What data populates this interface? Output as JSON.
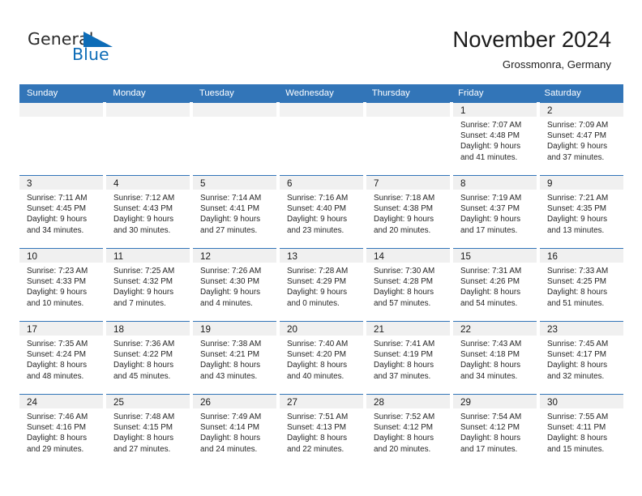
{
  "brand": {
    "word_one": "General",
    "word_two": "Blue",
    "triangle_icon": "blue-triangle-icon",
    "general_color": "#2b2b2b",
    "blue_color": "#0d6cb7"
  },
  "header": {
    "title": "November 2024",
    "subtitle": "Grossmonra, Germany"
  },
  "theme": {
    "header_blue": "#3275b8",
    "daynum_band": "#f0f0f0",
    "text": "#262626"
  },
  "weekdays": [
    "Sunday",
    "Monday",
    "Tuesday",
    "Wednesday",
    "Thursday",
    "Friday",
    "Saturday"
  ],
  "weeks": [
    [
      {
        "blank": true
      },
      {
        "blank": true
      },
      {
        "blank": true
      },
      {
        "blank": true
      },
      {
        "blank": true
      },
      {
        "day": "1",
        "sunrise": "Sunrise: 7:07 AM",
        "sunset": "Sunset: 4:48 PM",
        "daylight1": "Daylight: 9 hours",
        "daylight2": "and 41 minutes."
      },
      {
        "day": "2",
        "sunrise": "Sunrise: 7:09 AM",
        "sunset": "Sunset: 4:47 PM",
        "daylight1": "Daylight: 9 hours",
        "daylight2": "and 37 minutes."
      }
    ],
    [
      {
        "day": "3",
        "sunrise": "Sunrise: 7:11 AM",
        "sunset": "Sunset: 4:45 PM",
        "daylight1": "Daylight: 9 hours",
        "daylight2": "and 34 minutes."
      },
      {
        "day": "4",
        "sunrise": "Sunrise: 7:12 AM",
        "sunset": "Sunset: 4:43 PM",
        "daylight1": "Daylight: 9 hours",
        "daylight2": "and 30 minutes."
      },
      {
        "day": "5",
        "sunrise": "Sunrise: 7:14 AM",
        "sunset": "Sunset: 4:41 PM",
        "daylight1": "Daylight: 9 hours",
        "daylight2": "and 27 minutes."
      },
      {
        "day": "6",
        "sunrise": "Sunrise: 7:16 AM",
        "sunset": "Sunset: 4:40 PM",
        "daylight1": "Daylight: 9 hours",
        "daylight2": "and 23 minutes."
      },
      {
        "day": "7",
        "sunrise": "Sunrise: 7:18 AM",
        "sunset": "Sunset: 4:38 PM",
        "daylight1": "Daylight: 9 hours",
        "daylight2": "and 20 minutes."
      },
      {
        "day": "8",
        "sunrise": "Sunrise: 7:19 AM",
        "sunset": "Sunset: 4:37 PM",
        "daylight1": "Daylight: 9 hours",
        "daylight2": "and 17 minutes."
      },
      {
        "day": "9",
        "sunrise": "Sunrise: 7:21 AM",
        "sunset": "Sunset: 4:35 PM",
        "daylight1": "Daylight: 9 hours",
        "daylight2": "and 13 minutes."
      }
    ],
    [
      {
        "day": "10",
        "sunrise": "Sunrise: 7:23 AM",
        "sunset": "Sunset: 4:33 PM",
        "daylight1": "Daylight: 9 hours",
        "daylight2": "and 10 minutes."
      },
      {
        "day": "11",
        "sunrise": "Sunrise: 7:25 AM",
        "sunset": "Sunset: 4:32 PM",
        "daylight1": "Daylight: 9 hours",
        "daylight2": "and 7 minutes."
      },
      {
        "day": "12",
        "sunrise": "Sunrise: 7:26 AM",
        "sunset": "Sunset: 4:30 PM",
        "daylight1": "Daylight: 9 hours",
        "daylight2": "and 4 minutes."
      },
      {
        "day": "13",
        "sunrise": "Sunrise: 7:28 AM",
        "sunset": "Sunset: 4:29 PM",
        "daylight1": "Daylight: 9 hours",
        "daylight2": "and 0 minutes."
      },
      {
        "day": "14",
        "sunrise": "Sunrise: 7:30 AM",
        "sunset": "Sunset: 4:28 PM",
        "daylight1": "Daylight: 8 hours",
        "daylight2": "and 57 minutes."
      },
      {
        "day": "15",
        "sunrise": "Sunrise: 7:31 AM",
        "sunset": "Sunset: 4:26 PM",
        "daylight1": "Daylight: 8 hours",
        "daylight2": "and 54 minutes."
      },
      {
        "day": "16",
        "sunrise": "Sunrise: 7:33 AM",
        "sunset": "Sunset: 4:25 PM",
        "daylight1": "Daylight: 8 hours",
        "daylight2": "and 51 minutes."
      }
    ],
    [
      {
        "day": "17",
        "sunrise": "Sunrise: 7:35 AM",
        "sunset": "Sunset: 4:24 PM",
        "daylight1": "Daylight: 8 hours",
        "daylight2": "and 48 minutes."
      },
      {
        "day": "18",
        "sunrise": "Sunrise: 7:36 AM",
        "sunset": "Sunset: 4:22 PM",
        "daylight1": "Daylight: 8 hours",
        "daylight2": "and 45 minutes."
      },
      {
        "day": "19",
        "sunrise": "Sunrise: 7:38 AM",
        "sunset": "Sunset: 4:21 PM",
        "daylight1": "Daylight: 8 hours",
        "daylight2": "and 43 minutes."
      },
      {
        "day": "20",
        "sunrise": "Sunrise: 7:40 AM",
        "sunset": "Sunset: 4:20 PM",
        "daylight1": "Daylight: 8 hours",
        "daylight2": "and 40 minutes."
      },
      {
        "day": "21",
        "sunrise": "Sunrise: 7:41 AM",
        "sunset": "Sunset: 4:19 PM",
        "daylight1": "Daylight: 8 hours",
        "daylight2": "and 37 minutes."
      },
      {
        "day": "22",
        "sunrise": "Sunrise: 7:43 AM",
        "sunset": "Sunset: 4:18 PM",
        "daylight1": "Daylight: 8 hours",
        "daylight2": "and 34 minutes."
      },
      {
        "day": "23",
        "sunrise": "Sunrise: 7:45 AM",
        "sunset": "Sunset: 4:17 PM",
        "daylight1": "Daylight: 8 hours",
        "daylight2": "and 32 minutes."
      }
    ],
    [
      {
        "day": "24",
        "sunrise": "Sunrise: 7:46 AM",
        "sunset": "Sunset: 4:16 PM",
        "daylight1": "Daylight: 8 hours",
        "daylight2": "and 29 minutes."
      },
      {
        "day": "25",
        "sunrise": "Sunrise: 7:48 AM",
        "sunset": "Sunset: 4:15 PM",
        "daylight1": "Daylight: 8 hours",
        "daylight2": "and 27 minutes."
      },
      {
        "day": "26",
        "sunrise": "Sunrise: 7:49 AM",
        "sunset": "Sunset: 4:14 PM",
        "daylight1": "Daylight: 8 hours",
        "daylight2": "and 24 minutes."
      },
      {
        "day": "27",
        "sunrise": "Sunrise: 7:51 AM",
        "sunset": "Sunset: 4:13 PM",
        "daylight1": "Daylight: 8 hours",
        "daylight2": "and 22 minutes."
      },
      {
        "day": "28",
        "sunrise": "Sunrise: 7:52 AM",
        "sunset": "Sunset: 4:12 PM",
        "daylight1": "Daylight: 8 hours",
        "daylight2": "and 20 minutes."
      },
      {
        "day": "29",
        "sunrise": "Sunrise: 7:54 AM",
        "sunset": "Sunset: 4:12 PM",
        "daylight1": "Daylight: 8 hours",
        "daylight2": "and 17 minutes."
      },
      {
        "day": "30",
        "sunrise": "Sunrise: 7:55 AM",
        "sunset": "Sunset: 4:11 PM",
        "daylight1": "Daylight: 8 hours",
        "daylight2": "and 15 minutes."
      }
    ]
  ]
}
